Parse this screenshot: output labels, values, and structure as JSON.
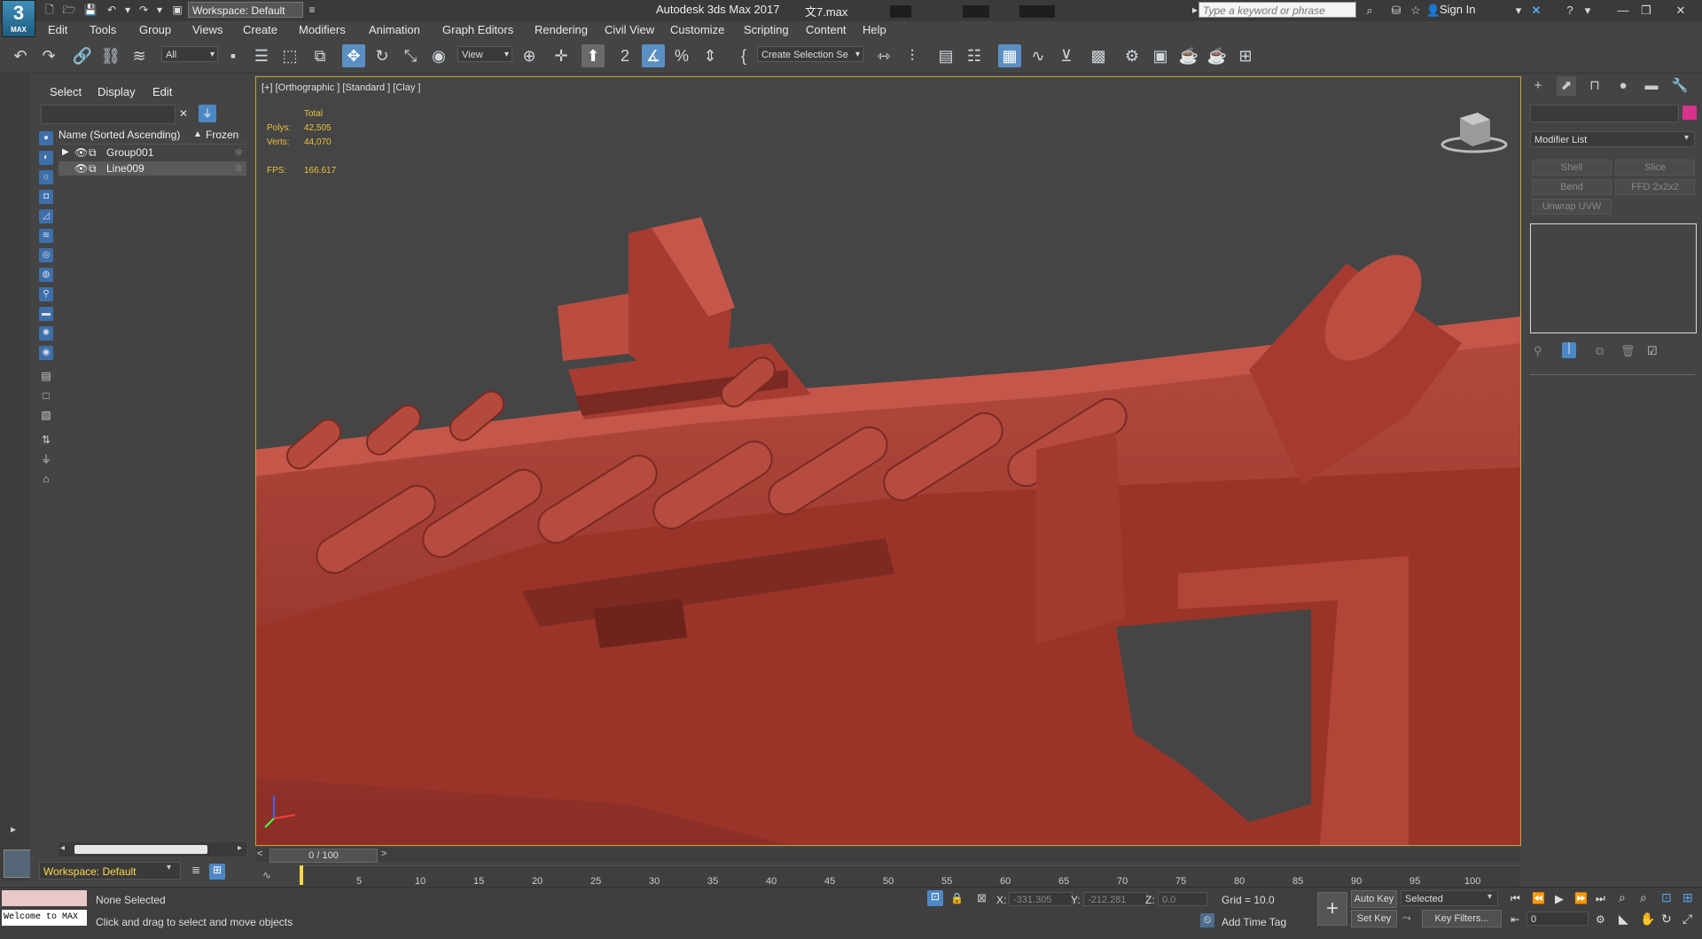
{
  "title_bar": {
    "logo_text": "3",
    "logo_sub": "MAX",
    "workspace_label": "Workspace: Default",
    "app_title": "Autodesk 3ds Max 2017",
    "file_name": "文7.max",
    "search_placeholder": "Type a keyword or phrase",
    "sign_in": "Sign In"
  },
  "menu": [
    "Edit",
    "Tools",
    "Group",
    "Views",
    "Create",
    "Modifiers",
    "Animation",
    "Graph Editors",
    "Rendering",
    "Civil View",
    "Customize",
    "Scripting",
    "Content",
    "Help"
  ],
  "toolbar": {
    "filter_value": "All",
    "ref_coord": "View",
    "selection_set": "Create Selection Se"
  },
  "explorer": {
    "tabs": [
      "Select",
      "Display",
      "Edit"
    ],
    "column_name": "Name (Sorted Ascending)",
    "sort_arrow": "▲",
    "column_frozen": "Frozen",
    "items": [
      {
        "name": "Group001",
        "expander": "▶"
      },
      {
        "name": "Line009",
        "expander": ""
      }
    ],
    "workspace_bottom": "Workspace: Default"
  },
  "viewport": {
    "label": "[+] [Orthographic ] [Standard ] [Clay ]",
    "stats": {
      "total_label": "Total",
      "polys_label": "Polys:",
      "polys_value": "42,505",
      "verts_label": "Verts:",
      "verts_value": "44,070",
      "fps_label": "FPS:",
      "fps_value": "166.617"
    },
    "model_color": "#a0382e",
    "background_color": "#454545"
  },
  "command_panel": {
    "modifier_list": "Modifier List",
    "modifier_buttons": [
      "Shell",
      "Slice",
      "Bend",
      "FFD 2x2x2",
      "Unwrap UVW"
    ],
    "object_color": "#d6338a"
  },
  "timeline": {
    "frame_display": "0 / 100",
    "prev_arrow": "<",
    "next_arrow": ">",
    "ticks": [
      "5",
      "10",
      "15",
      "20",
      "25",
      "30",
      "35",
      "40",
      "45",
      "50",
      "55",
      "60",
      "65",
      "70",
      "75",
      "80",
      "85",
      "90",
      "95",
      "100"
    ]
  },
  "status": {
    "listener_text": "Welcome to MAX",
    "selection_text": "None Selected",
    "prompt_text": "Click and drag to select and move objects",
    "x_label": "X:",
    "x_value": "-331.305",
    "y_label": "Y:",
    "y_value": "-212.281",
    "z_label": "Z:",
    "z_value": "0.0",
    "grid": "Grid = 10.0",
    "add_time_tag": "Add Time Tag",
    "auto_key": "Auto Key",
    "set_key": "Set Key",
    "selected_dropdown": "Selected",
    "key_filters": "Key Filters...",
    "frame_value": "0"
  }
}
